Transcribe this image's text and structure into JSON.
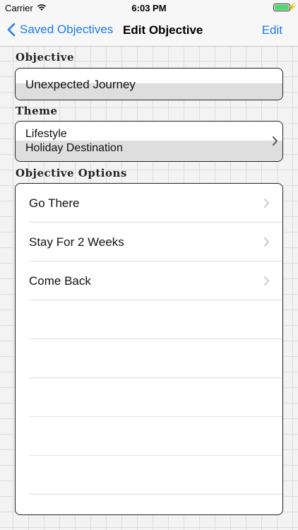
{
  "status": {
    "carrier": "Carrier",
    "time": "6:03 PM"
  },
  "nav": {
    "back_label": "Saved Objectives",
    "title": "Edit Objective",
    "edit_label": "Edit"
  },
  "objective": {
    "label": "Objective",
    "value": "Unexpected Journey"
  },
  "theme": {
    "label": "Theme",
    "line1": "Lifestyle",
    "line2": "Holiday Destination"
  },
  "options": {
    "label": "Objective Options",
    "items": [
      {
        "label": "Go There"
      },
      {
        "label": "Stay For 2 Weeks"
      },
      {
        "label": "Come Back"
      }
    ]
  },
  "colors": {
    "accent": "#1a7cf5",
    "battery": "#4cd964"
  },
  "icons": {
    "back": "chevron-left-icon",
    "disclosure": "chevron-right-icon",
    "wifi": "wifi-icon",
    "battery": "battery-icon"
  }
}
